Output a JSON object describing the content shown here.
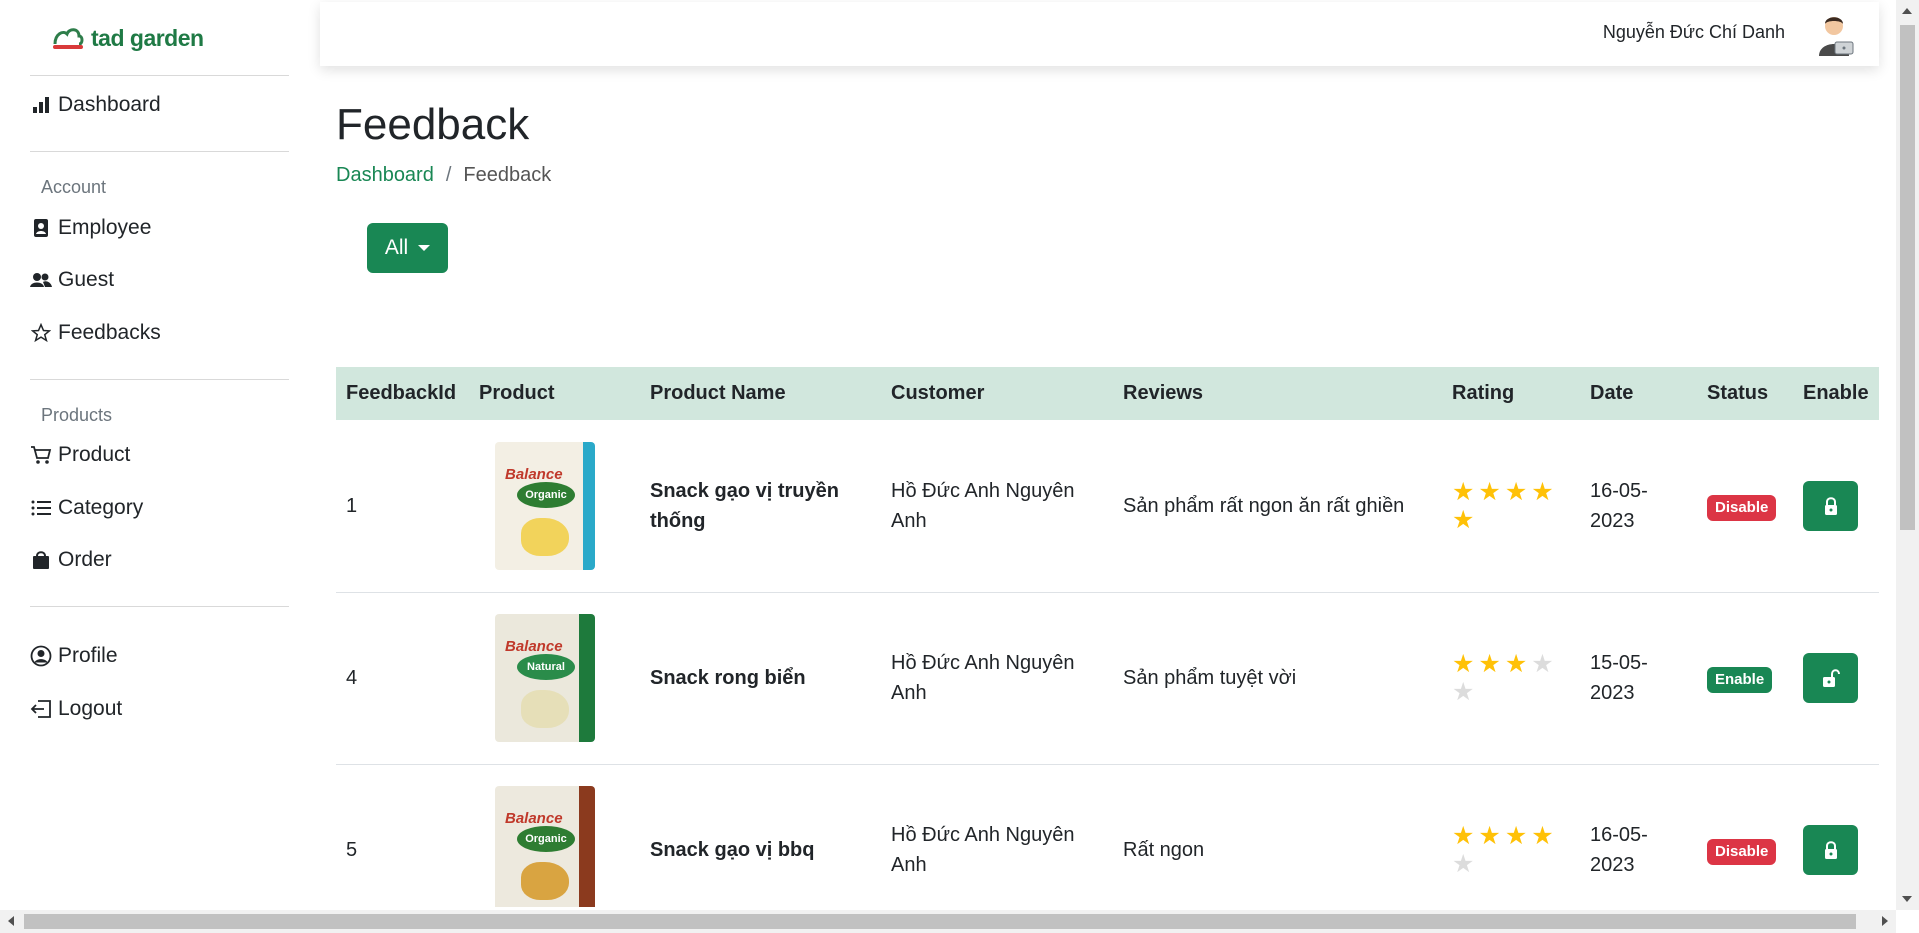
{
  "brand": {
    "name": "tad garden"
  },
  "sidebar": {
    "dashboard": "Dashboard",
    "account_heading": "Account",
    "employee": "Employee",
    "guest": "Guest",
    "feedbacks": "Feedbacks",
    "products_heading": "Products",
    "product": "Product",
    "category": "Category",
    "order": "Order",
    "profile": "Profile",
    "logout": "Logout"
  },
  "header": {
    "user_name": "Nguyễn Đức Chí Danh"
  },
  "page": {
    "title": "Feedback",
    "breadcrumb": {
      "home": "Dashboard",
      "separator": "/",
      "current": "Feedback"
    },
    "filter": {
      "selected": "All"
    }
  },
  "table": {
    "headers": [
      "FeedbackId",
      "Product",
      "Product Name",
      "Customer",
      "Reviews",
      "Rating",
      "Date",
      "Status",
      "Enable"
    ],
    "rows": [
      {
        "id": "1",
        "product_image": "Balance Organic",
        "product_name": "Snack gạo vị truyền thống",
        "customer": "Hồ Đức Anh Nguyên Anh",
        "review": "Sản phẩm rất ngon ăn rất ghiền",
        "rating": 5,
        "date": "16-05-2023",
        "status": "Disable",
        "lock_icon": "lock-icon"
      },
      {
        "id": "4",
        "product_image": "Balance Natural",
        "product_name": "Snack rong biển",
        "customer": "Hồ Đức Anh Nguyên Anh",
        "review": "Sản phẩm tuyệt vời",
        "rating": 3,
        "date": "15-05-2023",
        "status": "Enable",
        "lock_icon": "unlock-icon"
      },
      {
        "id": "5",
        "product_image": "Balance Organic",
        "product_name": "Snack gạo vị bbq",
        "customer": "Hồ Đức Anh Nguyên Anh",
        "review": "Rất ngon",
        "rating": 4,
        "date": "16-05-2023",
        "status": "Disable",
        "lock_icon": "lock-icon"
      }
    ]
  },
  "colors": {
    "primary": "#198754",
    "danger": "#dc3545",
    "header_row": "#d1e7dd",
    "star": "#ffc107"
  }
}
